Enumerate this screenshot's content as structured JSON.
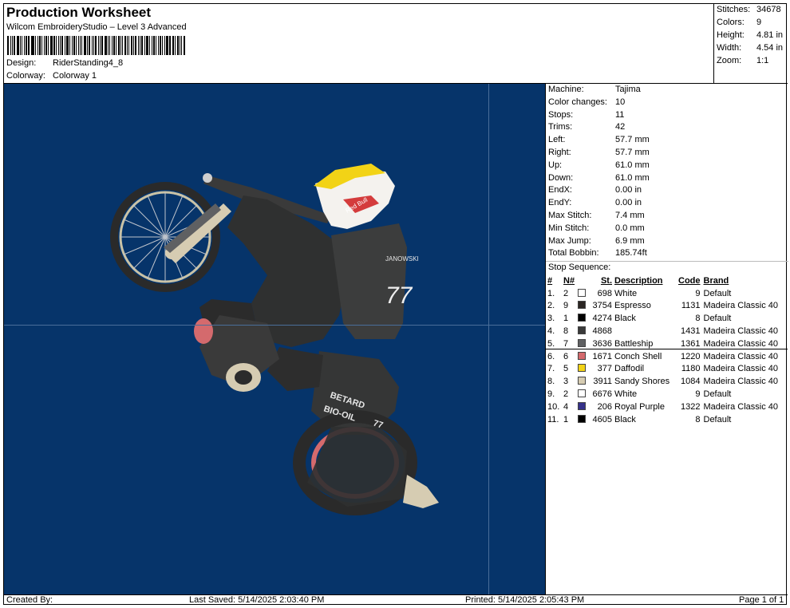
{
  "header": {
    "title": "Production Worksheet",
    "software": "Wilcom EmbroideryStudio – Level 3 Advanced",
    "design_label": "Design:",
    "design_value": "RiderStanding4_8",
    "colorway_label": "Colorway:",
    "colorway_value": "Colorway 1"
  },
  "stats": {
    "stitches_label": "Stitches:",
    "stitches": "34678",
    "colors_label": "Colors:",
    "colors": "9",
    "height_label": "Height:",
    "height": "4.81 in",
    "width_label": "Width:",
    "width": "4.54 in",
    "zoom_label": "Zoom:",
    "zoom": "1:1"
  },
  "machine": [
    {
      "label": "Machine:",
      "value": "Tajima"
    },
    {
      "label": "Color changes:",
      "value": "10"
    },
    {
      "label": "Stops:",
      "value": "11"
    },
    {
      "label": "Trims:",
      "value": "42"
    },
    {
      "label": "Left:",
      "value": "57.7 mm"
    },
    {
      "label": "Right:",
      "value": "57.7 mm"
    },
    {
      "label": "Up:",
      "value": "61.0 mm"
    },
    {
      "label": "Down:",
      "value": "61.0 mm"
    },
    {
      "label": "EndX:",
      "value": "0.00 in"
    },
    {
      "label": "EndY:",
      "value": "0.00 in"
    },
    {
      "label": "Max Stitch:",
      "value": "7.4 mm"
    },
    {
      "label": "Min Stitch:",
      "value": "0.0 mm"
    },
    {
      "label": "Max Jump:",
      "value": "6.9 mm"
    },
    {
      "label": "Total Bobbin:",
      "value": "185.74ft"
    }
  ],
  "stop_sequence": {
    "label": "Stop Sequence:",
    "headers": {
      "idx": "#",
      "n": "N#",
      "st": "St.",
      "desc": "Description",
      "code": "Code",
      "brand": "Brand"
    },
    "rows": [
      {
        "idx": "1.",
        "n": "2",
        "color": "#ffffff",
        "st": "698",
        "desc": "White",
        "code": "9",
        "brand": "Default"
      },
      {
        "idx": "2.",
        "n": "9",
        "color": "#2b2623",
        "st": "3754",
        "desc": "Espresso",
        "code": "1131",
        "brand": "Madeira Classic 40"
      },
      {
        "idx": "3.",
        "n": "1",
        "color": "#000000",
        "st": "4274",
        "desc": "Black",
        "code": "8",
        "brand": "Default"
      },
      {
        "idx": "4.",
        "n": "8",
        "color": "#3a3a3a",
        "st": "4868",
        "desc": "",
        "code": "1431",
        "brand": "Madeira Classic 40"
      },
      {
        "idx": "5.",
        "n": "7",
        "color": "#5f6062",
        "st": "3636",
        "desc": "Battleship",
        "code": "1361",
        "brand": "Madeira Classic 40"
      },
      {
        "idx": "6.",
        "n": "6",
        "color": "#d46a6d",
        "st": "1671",
        "desc": "Conch Shell",
        "code": "1220",
        "brand": "Madeira Classic 40"
      },
      {
        "idx": "7.",
        "n": "5",
        "color": "#f2d316",
        "st": "377",
        "desc": "Daffodil",
        "code": "1180",
        "brand": "Madeira Classic 40"
      },
      {
        "idx": "8.",
        "n": "3",
        "color": "#d6ccb2",
        "st": "3911",
        "desc": "Sandy Shores",
        "code": "1084",
        "brand": "Madeira Classic 40"
      },
      {
        "idx": "9.",
        "n": "2",
        "color": "#ffffff",
        "st": "6676",
        "desc": "White",
        "code": "9",
        "brand": "Default"
      },
      {
        "idx": "10.",
        "n": "4",
        "color": "#36328a",
        "st": "206",
        "desc": "Royal Purple",
        "code": "1322",
        "brand": "Madeira Classic 40"
      },
      {
        "idx": "11.",
        "n": "1",
        "color": "#000000",
        "st": "4605",
        "desc": "Black",
        "code": "8",
        "brand": "Default"
      }
    ]
  },
  "design_text": {
    "helmet": "Red Bull",
    "rider_name": "JANOWSKI",
    "number": "77",
    "sponsor1": "BETARD",
    "sponsor2": "BIO-OIL",
    "number_small": "77"
  },
  "colors": {
    "canvas_bg": "#06346a"
  },
  "footer": {
    "created_by": "Created By:",
    "last_saved": "Last Saved: 5/14/2025 2:03:40 PM",
    "printed": "Printed: 5/14/2025 2:05:43 PM",
    "page": "Page 1 of 1"
  }
}
